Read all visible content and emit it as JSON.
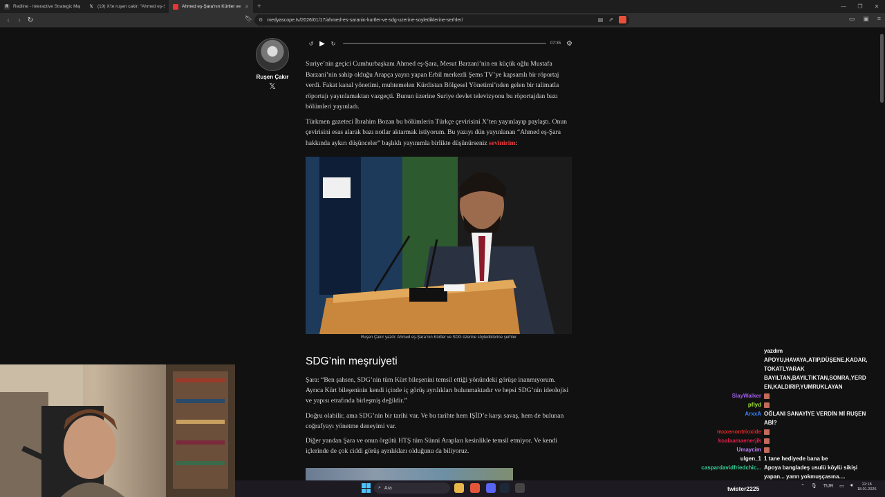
{
  "browser": {
    "tabs": [
      {
        "label": "Redline - Interactive Strategic Map",
        "active": false,
        "icon": "redline-favicon"
      },
      {
        "label": "(19) X'te ruşen cakir: \"Ahmed eş-Şara...",
        "active": false,
        "icon": "x-favicon"
      },
      {
        "label": "Ahmed eş-Şara'nın Kürtler ve SD...",
        "active": true,
        "icon": "medyascope-favicon"
      }
    ],
    "url": "medyascope.tv/2026/01/17/ahmed-es-saranin-kurtler-ve-sdg-uzerine-soylediklerine-serhler/"
  },
  "author": {
    "name": "Ruşen Çakır"
  },
  "audio": {
    "duration": "07:35"
  },
  "article": {
    "p1": "Suriye’nin geçici Cumhurbaşkanı Ahmed eş-Şara, Mesut Barzani’nin en küçük oğlu Mustafa Barzani’nin sahip olduğu Arapça yayın yapan Erbil merkezli Şems TV’ye kapsamlı bir röportaj verdi. Fakat kanal yönetimi, muhtemelen Kürdistan Bölgesel Yönetimi’nden gelen bir talimatla röportajı yayınlamaktan vazgeçti. Bunun üzerine Suriye devlet televizyonu bu röportajdan bazı bölümleri yayınladı.",
    "p2_text": "Türkmen gazeteci İbrahim Bozan bu bölümlerin Türkçe çevirisini X’ten yayınlayıp paylaştı. Onun çevirisini esas alarak bazı notlar aktarmak istiyorum. Bu yazıyı dün yayınlanan “Ahmed eş-Şara hakkında aykırı düşünceler” başlıklı yayınımla birlikte düşünürseniz ",
    "p2_link": "sevinirim",
    "p2_end": ":",
    "caption": "Ruşen Çakır yazdı: Ahmed eş-Şara’nın Kürtler ve SDG üzerine söylediklerine şerhler",
    "heading": "SDG’nin meşruiyeti",
    "p3": "Şara: “Ben şahsen, SDG’nin tüm Kürt bileşenini temsil ettiği yönündeki görüşe inanmıyorum. Ayrıca Kürt bileşeninin kendi içinde iç görüş ayrılıkları bulunmaktadır ve hepsi SDG’nin ideolojisi ve yapısı etrafında birleşmiş değildir.”",
    "p4": "Doğru olabilir, ama SDG’nin bir tarihi var. Ve bu tarihte hem IŞİD’e karşı savaş, hem de bulunan coğrafyayı yönetme deneyimi var.",
    "p5": "Diğer yandan Şara ve onun örgütü HTŞ tüm Sünni Arapları kesinlikle temsil etmiyor. Ve kendi içlerinde de çok ciddi görüş ayrılıkları olduğunu da biliyoruz."
  },
  "chat": [
    {
      "user": "",
      "color": "#ffffff",
      "msg": "yazdım"
    },
    {
      "user": "",
      "color": "#ffffff",
      "msg": "APOYU,HAVAYA,ATIP,DÜŞENE,KADAR,"
    },
    {
      "user": "",
      "color": "#ffffff",
      "msg": "TOKATLYARAK"
    },
    {
      "user": "",
      "color": "#ffffff",
      "msg": "BAYILTAN,BAYILTIKTAN,SONRA,YERD"
    },
    {
      "user": "",
      "color": "#ffffff",
      "msg": "EN,KALDIRIP,YUMRUKLAYAN"
    },
    {
      "user": "SlayWalker",
      "color": "#9b5de5",
      "msg": "",
      "emote": true
    },
    {
      "user": "pflyd",
      "color": "#a3e635",
      "msg": "",
      "emote": true
    },
    {
      "user": "ArxxA",
      "color": "#3b82f6",
      "msg": "OĞLANI SANAYİYE VERDİN Mİ RUŞEN"
    },
    {
      "user": "",
      "color": "#ffffff",
      "msg": "ABİ?"
    },
    {
      "user": "mxxenontrioxide",
      "color": "#dc2626",
      "msg": "",
      "emote": true
    },
    {
      "user": "koalaamaenerjik",
      "color": "#e11d48",
      "msg": "",
      "emote": true
    },
    {
      "user": "Umaycim",
      "color": "#c084fc",
      "msg": "",
      "emote": true
    },
    {
      "user": "ulgen_1",
      "color": "#f5f5f5",
      "msg": "1 tane hediyede bana be"
    },
    {
      "user": "caspardavidfriedchic...",
      "color": "#34d399",
      "msg": "Apoya bangladeş usulü köylü sikişi"
    },
    {
      "user": "",
      "color": "#ffffff",
      "msg": "yapan... yarın yokmuşçasına...."
    }
  ],
  "taskbar": {
    "search_placeholder": "Ara",
    "chat_user": "twister2225",
    "language": "TUR",
    "time": "22:18",
    "date": "18.01.2026"
  }
}
